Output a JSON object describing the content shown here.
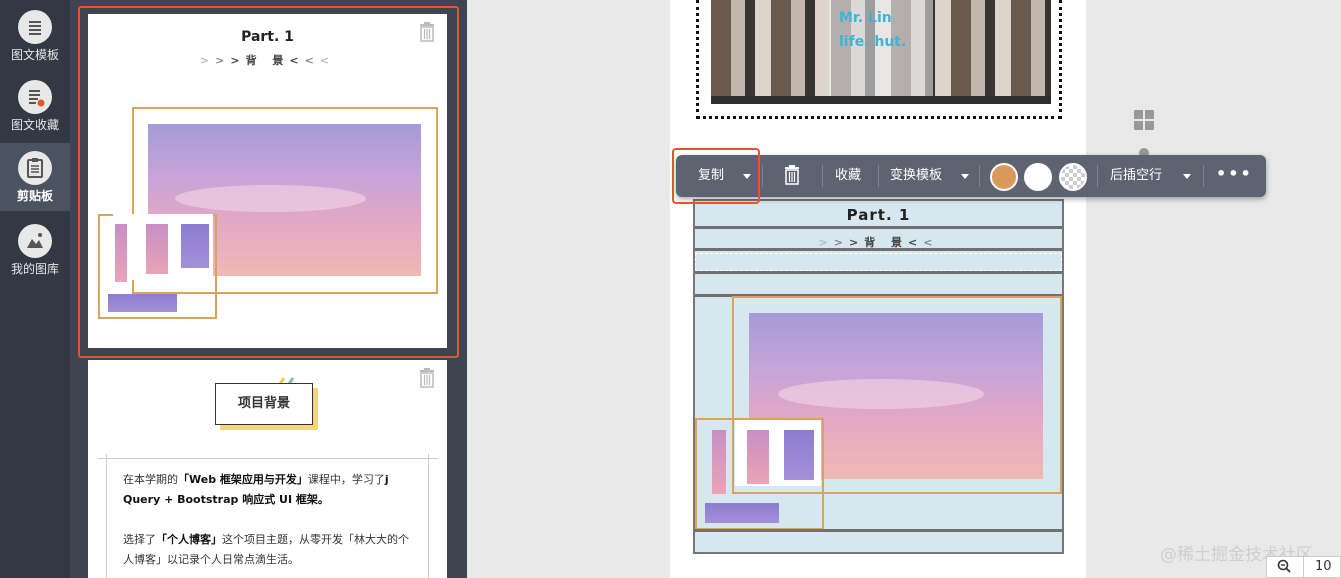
{
  "sidebar": {
    "items": [
      {
        "label": "图文模板",
        "icon": "list-icon"
      },
      {
        "label": "图文收藏",
        "icon": "bookmark-list-icon"
      },
      {
        "label": "剪贴板",
        "icon": "clipboard-icon"
      },
      {
        "label": "我的图库",
        "icon": "image-icon"
      }
    ],
    "active_index": 2
  },
  "clipboard": {
    "cards": [
      {
        "title": "Part. 1",
        "subtitle": "背 景"
      },
      {
        "tag": "项目背景",
        "paragraph1_prefix": "在本学期的",
        "paragraph1_bold1": "「Web 框架应用与开发」",
        "paragraph1_mid": "课程中，学习了",
        "paragraph1_bold2": "j Query + Bootstrap 响应式 UI 框架。",
        "paragraph2_prefix": "选择了",
        "paragraph2_bold": "「个人博客」",
        "paragraph2_rest": "这个项目主题，从零开发「林大大的个人博客」以记录个人日常点滴生活。"
      }
    ]
  },
  "canvas": {
    "photo_overlay_line1": "Mr. Lin",
    "photo_overlay_line2": "life. hut.",
    "block_title": "Part. 1",
    "block_subtitle": "背 景"
  },
  "toolbar": {
    "copy_label": "复制",
    "collect_label": "收藏",
    "change_template_label": "变换模板",
    "insert_row_label": "后插空行",
    "swatches": [
      "#d99a5b",
      "#ffffff",
      "transparent"
    ],
    "more_label": "•••"
  },
  "watermark": "@稀土掘金技术社区",
  "zoom_value": "10"
}
